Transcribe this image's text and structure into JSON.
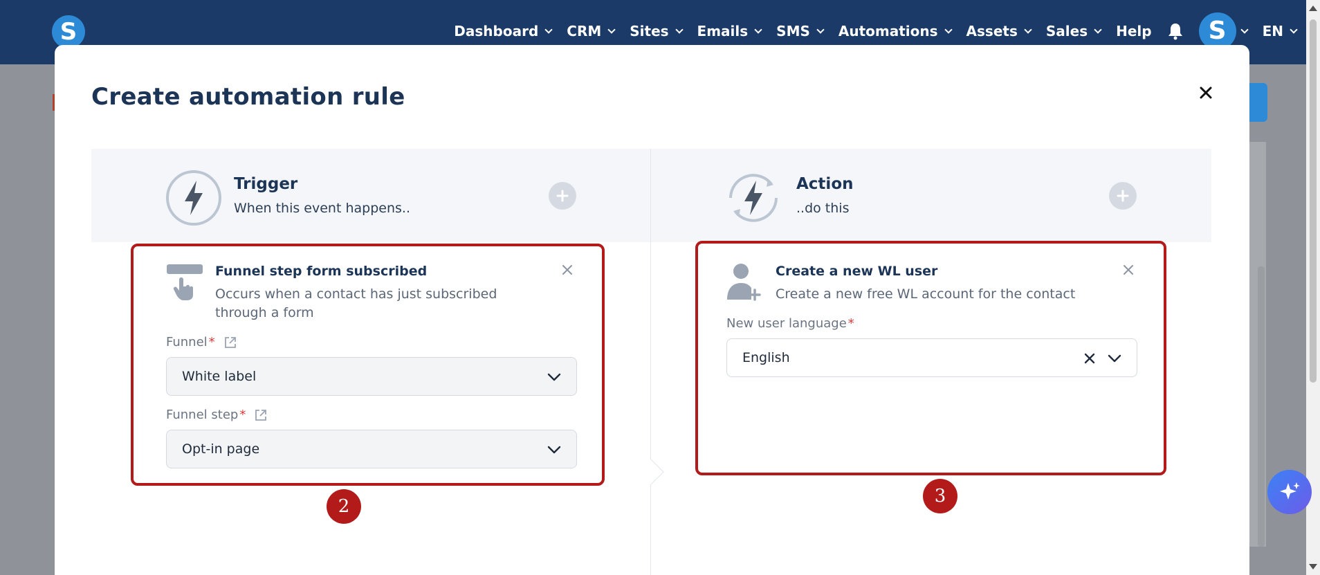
{
  "nav": {
    "logo": "S",
    "items": [
      {
        "label": "Dashboard",
        "dropdown": true
      },
      {
        "label": "CRM",
        "dropdown": true
      },
      {
        "label": "Sites",
        "dropdown": true
      },
      {
        "label": "Emails",
        "dropdown": true
      },
      {
        "label": "SMS",
        "dropdown": true
      },
      {
        "label": "Automations",
        "dropdown": true
      },
      {
        "label": "Assets",
        "dropdown": true
      },
      {
        "label": "Sales",
        "dropdown": true
      },
      {
        "label": "Help",
        "dropdown": false
      }
    ],
    "avatar_letter": "S",
    "language": "EN"
  },
  "modal": {
    "title": "Create automation rule",
    "trigger": {
      "title": "Trigger",
      "subtitle": "When this event happens..",
      "card": {
        "title": "Funnel step form subscribed",
        "description": "Occurs when a contact has just subscribed through a form",
        "funnel_label": "Funnel",
        "funnel_value": "White label",
        "step_label": "Funnel step",
        "step_value": "Opt-in page"
      }
    },
    "action": {
      "title": "Action",
      "subtitle": "..do this",
      "card": {
        "title": "Create a new WL user",
        "description": "Create a new free WL account for the contact",
        "language_label": "New user language",
        "language_value": "English"
      }
    },
    "required_mark": "*"
  },
  "annotations": {
    "badge_left": "2",
    "badge_right": "3"
  },
  "colors": {
    "nav_bg": "#1b3a68",
    "brand_blue": "#2d8ad6",
    "title_text": "#1c3557",
    "highlight_red": "#b31b1b",
    "header_panel": "#f4f6f9"
  }
}
